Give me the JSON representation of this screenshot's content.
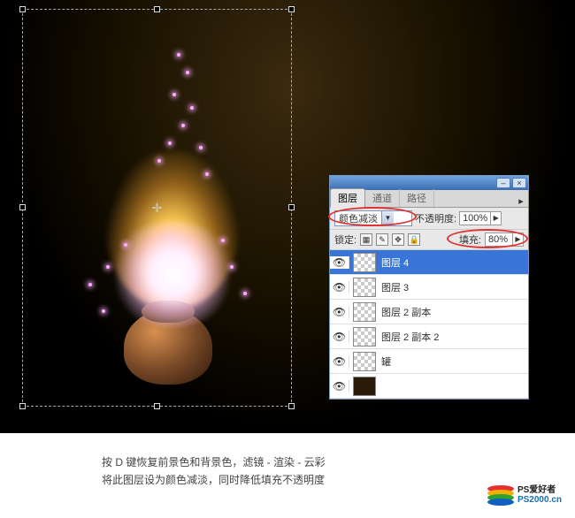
{
  "canvas": {
    "transform_active": true
  },
  "panel": {
    "tabs": [
      "图层",
      "通道",
      "路径"
    ],
    "active_tab": 0,
    "blend_mode": "颜色减淡",
    "opacity_label": "不透明度:",
    "opacity_value": "100%",
    "lock_label": "锁定:",
    "fill_label": "填充:",
    "fill_value": "80%",
    "layers": [
      {
        "name": "图层 4",
        "visible": true,
        "selected": true,
        "thumb": "checker"
      },
      {
        "name": "图层 3",
        "visible": true,
        "thumb": "checker"
      },
      {
        "name": "图层 2 副本",
        "visible": true,
        "thumb": "checker"
      },
      {
        "name": "图层 2 副本 2",
        "visible": true,
        "thumb": "checker"
      },
      {
        "name": "罐",
        "visible": true,
        "thumb": "checker"
      },
      {
        "name": "",
        "visible": true,
        "thumb": "solid"
      }
    ]
  },
  "caption": {
    "line1": "按 D 键恢复前景色和背景色，滤镜 - 渲染 - 云彩",
    "line2": "将此图层设为颜色减淡，同时降低填充不透明度"
  },
  "logo": {
    "text1": "PS爱好者",
    "text2": "PS2000.cn"
  }
}
